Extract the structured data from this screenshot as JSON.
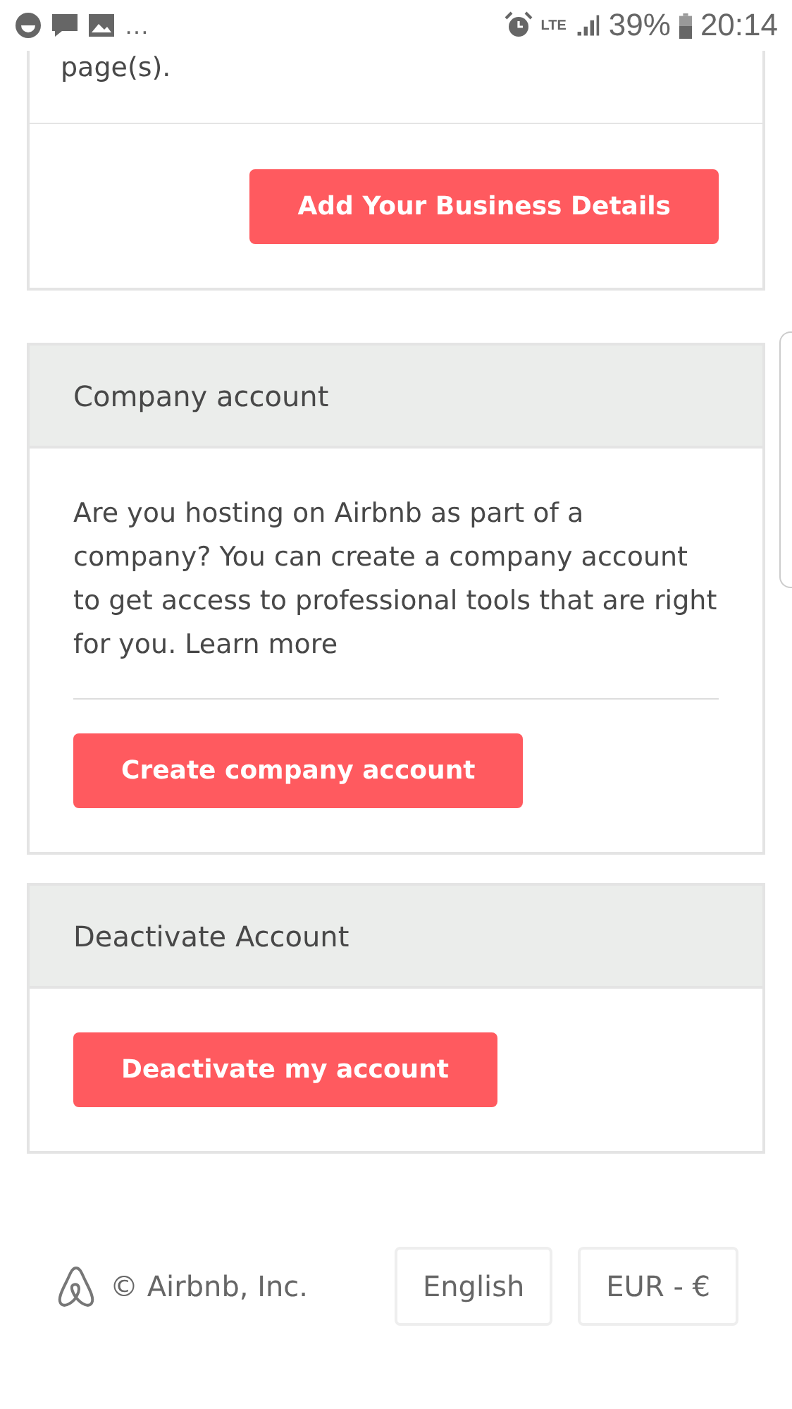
{
  "status_bar": {
    "more": "…",
    "network": "LTE",
    "battery": "39%",
    "time": "20:14"
  },
  "business_card": {
    "text": "page(s).",
    "button": "Add Your Business Details"
  },
  "company_card": {
    "title": "Company account",
    "body": "Are you hosting on Airbnb as part of a company? You can create a company account to get access to professional tools that are right for you.",
    "link": "Learn more",
    "button": "Create company account"
  },
  "deactivate_card": {
    "title": "Deactivate Account",
    "button": "Deactivate my account"
  },
  "footer": {
    "copyright": "© Airbnb, Inc.",
    "language": "English",
    "currency": "EUR - €"
  }
}
